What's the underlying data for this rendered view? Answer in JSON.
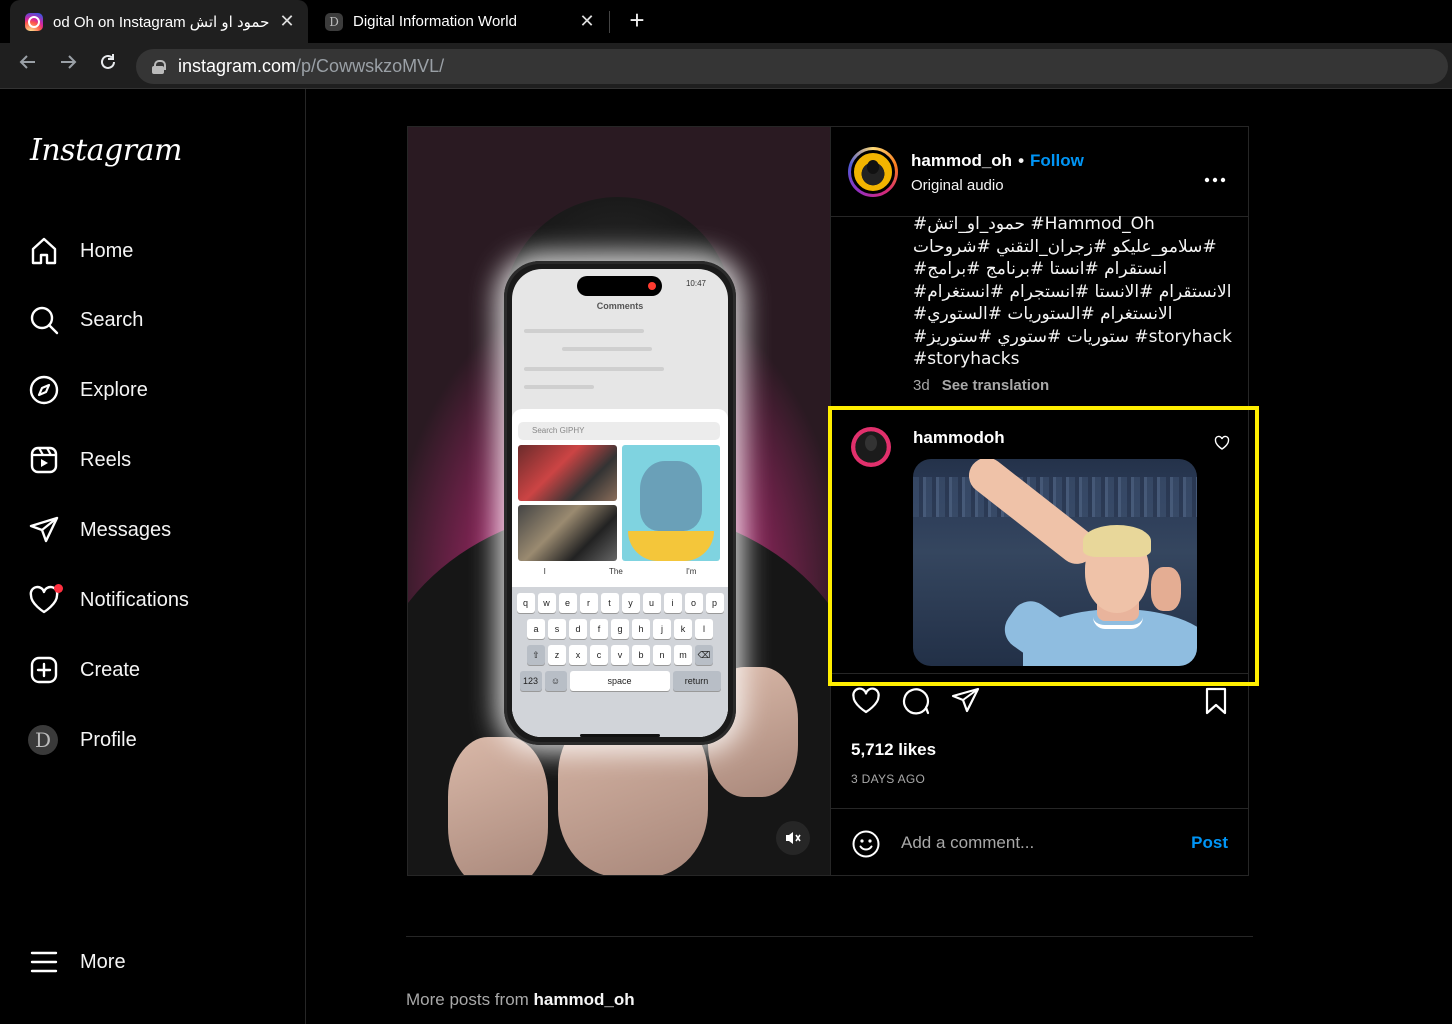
{
  "browser": {
    "tabs": [
      {
        "title": "od Oh on Instagram حمود او اتش",
        "close": "✕",
        "favicon": "instagram-icon"
      },
      {
        "title": "Digital Information World",
        "close": "✕",
        "favicon": "dw-icon"
      }
    ],
    "new_tab": "+",
    "url_host": "instagram.com",
    "url_path": "/p/CowwskzoMVL/"
  },
  "sidebar": {
    "logo": "Instagram",
    "items": [
      {
        "label": "Home",
        "icon": "home-icon"
      },
      {
        "label": "Search",
        "icon": "search-icon"
      },
      {
        "label": "Explore",
        "icon": "compass-icon"
      },
      {
        "label": "Reels",
        "icon": "reels-icon"
      },
      {
        "label": "Messages",
        "icon": "send-icon"
      },
      {
        "label": "Notifications",
        "icon": "heart-icon"
      },
      {
        "label": "Create",
        "icon": "plus-square-icon"
      },
      {
        "label": "Profile",
        "icon": "avatar"
      }
    ],
    "profile_initial": "D",
    "more": "More"
  },
  "post": {
    "username": "hammod_oh",
    "follow": "Follow",
    "separator": "•",
    "audio": "Original audio",
    "more_options": "•••",
    "caption_lines": [
      "#حمود_او_اتش #Hammod_Oh",
      "سلامو_عليكو #زجران_التقني #شروحات#",
      "#انستقرام #انستا #برنامج #برامج",
      "#الانستقرام #الانستا #انستجرام #انستغرام",
      "#الانستغرام #الستوريات #الستوري",
      "#ستوريات #ستوري #ستوريز #storyhack",
      "#storyhacks"
    ],
    "time": "3d",
    "see_translation": "See translation",
    "comment": {
      "username": "hammodoh"
    },
    "likes": "5,712 likes",
    "ago": "3 DAYS AGO",
    "add_comment_placeholder": "Add a comment...",
    "post_button": "Post"
  },
  "phone_screen": {
    "time": "10:47",
    "comments_title": "Comments",
    "giphy_placeholder": "Search GIPHY",
    "suggestions": [
      "I",
      "The",
      "I'm"
    ],
    "rows": [
      [
        "q",
        "w",
        "e",
        "r",
        "t",
        "y",
        "u",
        "i",
        "o",
        "p"
      ],
      [
        "a",
        "s",
        "d",
        "f",
        "g",
        "h",
        "j",
        "k",
        "l"
      ],
      [
        "z",
        "x",
        "c",
        "v",
        "b",
        "n",
        "m"
      ]
    ],
    "key_123": "123",
    "key_space": "space",
    "key_return": "return"
  },
  "more_posts": {
    "prefix": "More posts from ",
    "username": "hammod_oh"
  },
  "colors": {
    "accent": "#0095f6",
    "highlight": "#ffee00",
    "notification": "#ff3040"
  }
}
